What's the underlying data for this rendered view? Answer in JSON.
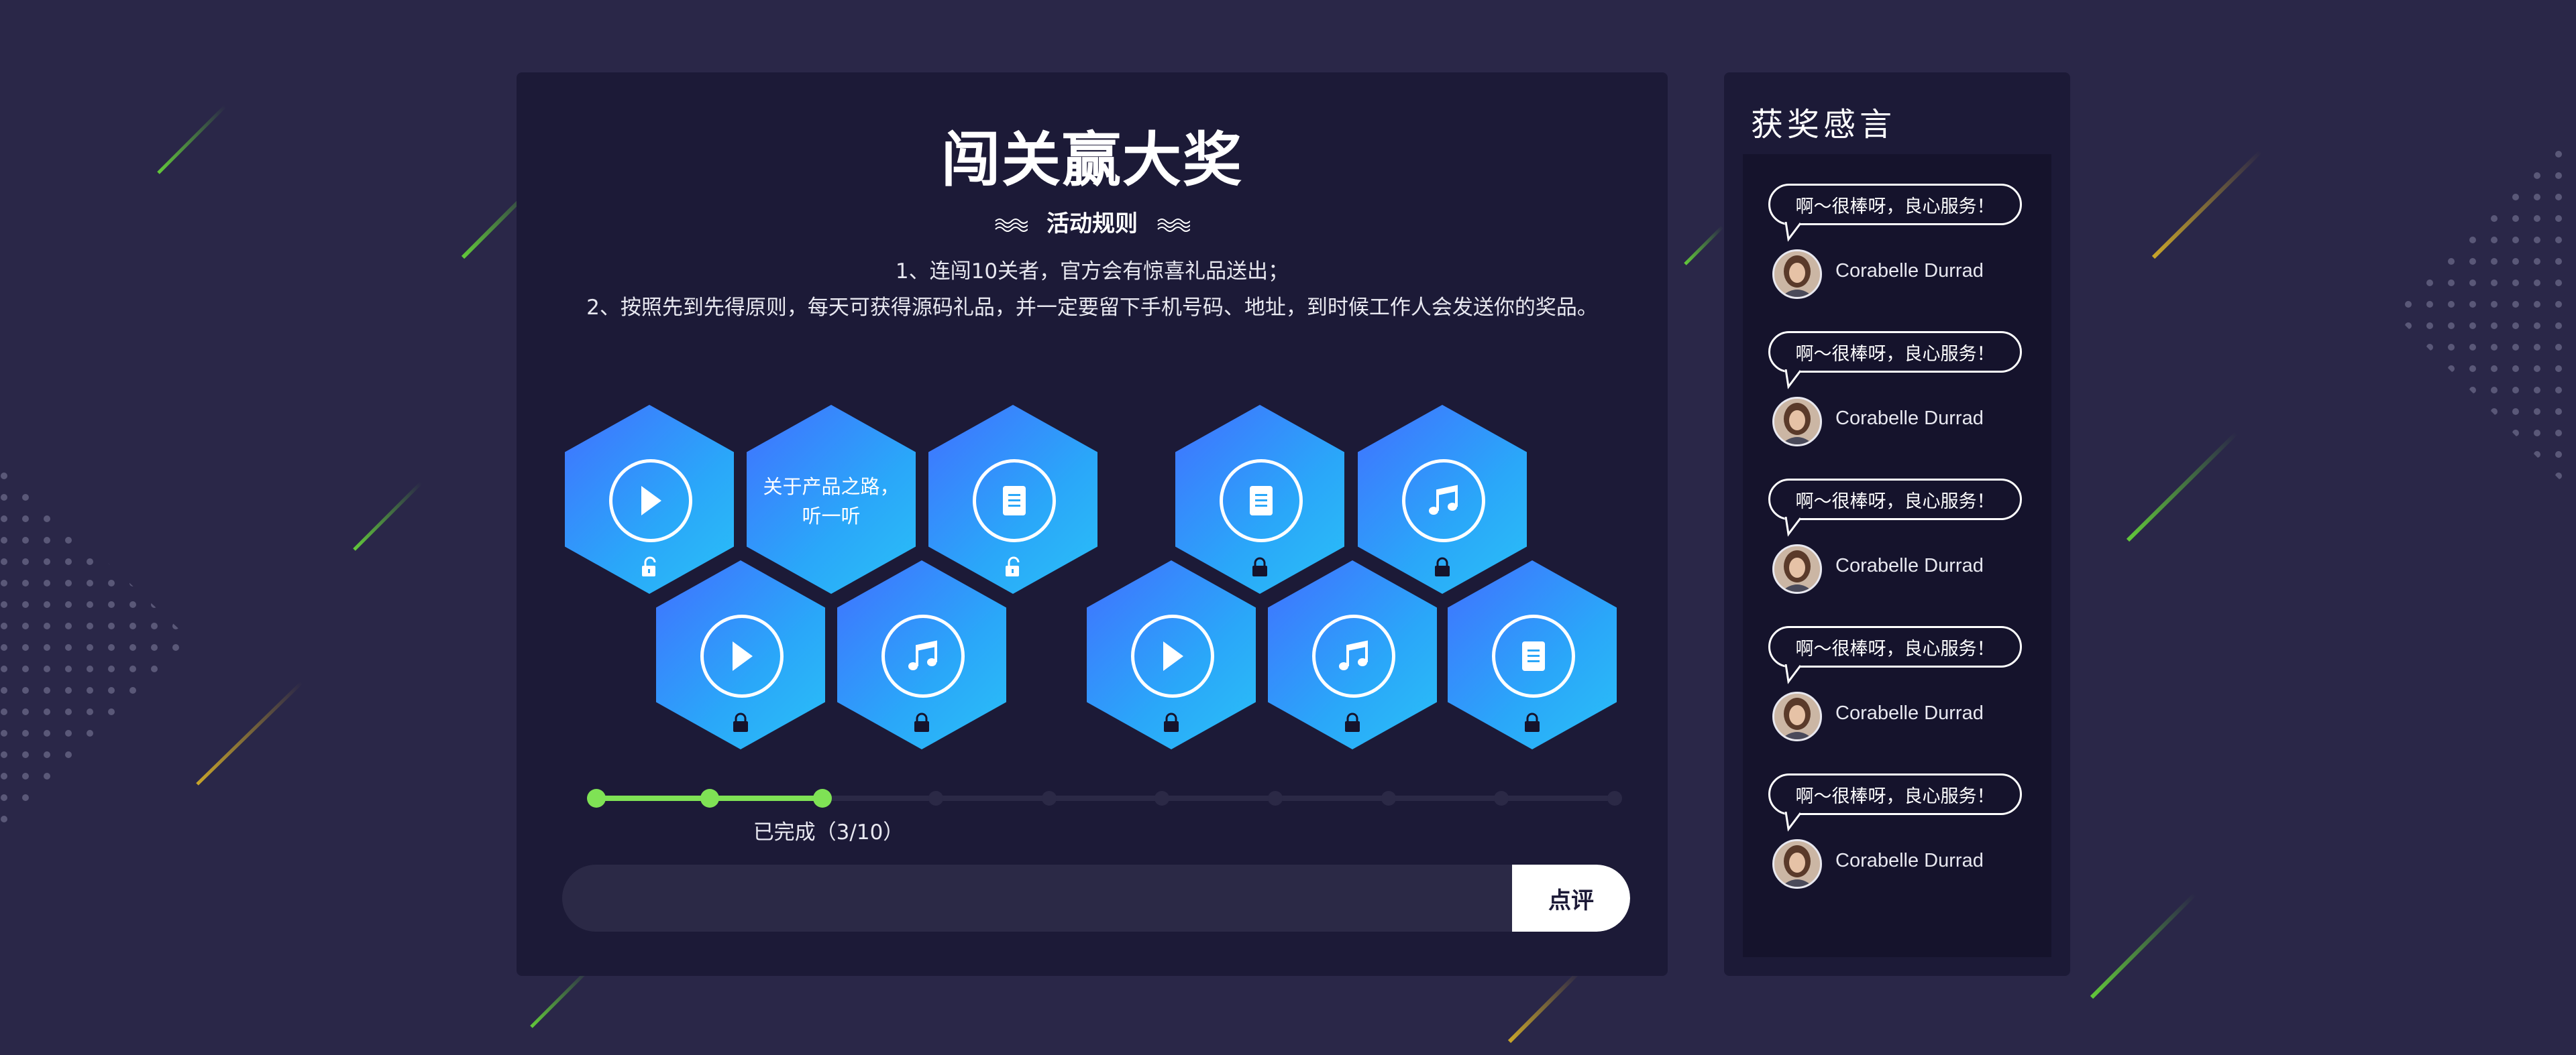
{
  "main": {
    "title": "闯关赢大奖",
    "rules_heading": "活动规则",
    "rules": [
      "1、连闯10关者，官方会有惊喜礼品送出；",
      "2、按照先到先得原则，每天可获得源码礼品，并一定要留下手机号码、地址，到时候工作人会发送你的奖品。"
    ],
    "levels": [
      {
        "type": "play",
        "state": "unlocked"
      },
      {
        "type": "text",
        "text_line1": "关于产品之路，",
        "text_line2": "听一听"
      },
      {
        "type": "doc",
        "state": "unlocked"
      },
      {
        "type": "play",
        "state": "locked"
      },
      {
        "type": "music",
        "state": "locked"
      },
      {
        "type": "doc",
        "state": "locked"
      },
      {
        "type": "music",
        "state": "locked"
      },
      {
        "type": "play",
        "state": "locked"
      },
      {
        "type": "music",
        "state": "locked"
      },
      {
        "type": "doc",
        "state": "locked"
      }
    ],
    "progress": {
      "completed": 3,
      "total": 10,
      "label": "已完成（3/10）"
    },
    "comment": {
      "placeholder": "",
      "button_label": "点评"
    }
  },
  "sidebar": {
    "title": "获奖感言",
    "reviews": [
      {
        "text": "啊～很棒呀，良心服务！",
        "user": "Corabelle Durrad"
      },
      {
        "text": "啊～很棒呀，良心服务！",
        "user": "Corabelle Durrad"
      },
      {
        "text": "啊～很棒呀，良心服务！",
        "user": "Corabelle Durrad"
      },
      {
        "text": "啊～很棒呀，良心服务！",
        "user": "Corabelle Durrad"
      },
      {
        "text": "啊～很棒呀，良心服务！",
        "user": "Corabelle Durrad"
      }
    ]
  },
  "colors": {
    "background": "#2a2748",
    "panel": "#1c1a37",
    "hex_gradient_start": "#4170ff",
    "hex_gradient_end": "#29c0f7",
    "progress_done": "#7fe255",
    "progress_track": "#2b2946"
  },
  "icons": [
    "play-icon",
    "doc-icon",
    "music-icon",
    "unlock-icon",
    "lock-icon",
    "wave-icon"
  ]
}
